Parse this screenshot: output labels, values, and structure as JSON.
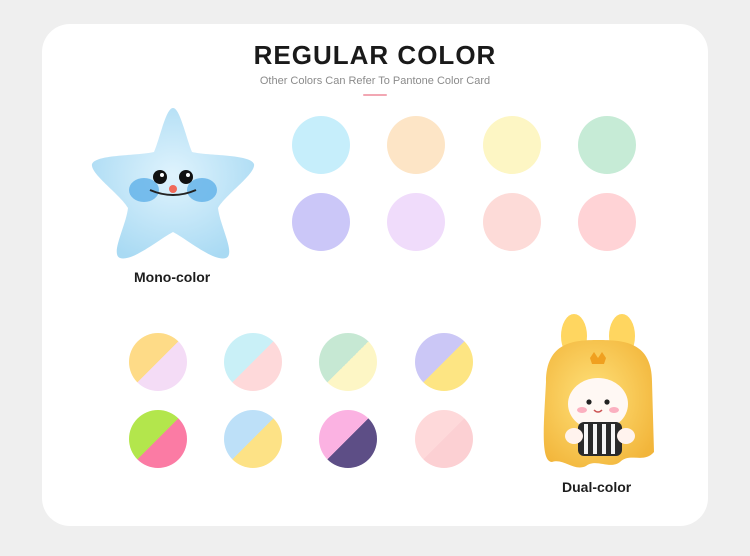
{
  "heading": {
    "title": "REGULAR COLOR",
    "subtitle": "Other Colors Can Refer To Pantone Color Card"
  },
  "mono": {
    "label": "Mono-color",
    "swatches": [
      "#c6eefb",
      "#fde5c6",
      "#fdf6c4",
      "#c6ebd6",
      "#cbc7f8",
      "#f0dcfb",
      "#fddbd8",
      "#ffd3d6"
    ]
  },
  "dual": {
    "label": "Dual-color",
    "swatches": [
      [
        "#fedb87",
        "#f4dcf6"
      ],
      [
        "#c9f0f7",
        "#fed9da"
      ],
      [
        "#c6e8d3",
        "#fdf6c5"
      ],
      [
        "#cbc7f6",
        "#fde583"
      ],
      [
        "#b3e64c",
        "#fb7ba4"
      ],
      [
        "#bde0f8",
        "#fde286"
      ],
      [
        "#fbb2e2",
        "#5d4e86"
      ],
      [
        "#fed9da",
        "#fcd0d3"
      ]
    ]
  }
}
